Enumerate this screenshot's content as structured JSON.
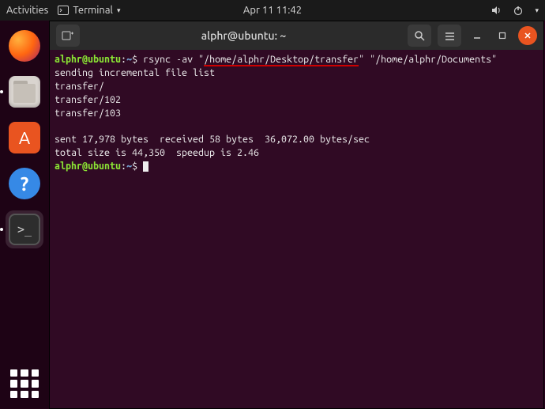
{
  "topbar": {
    "activities": "Activities",
    "app_label": "Terminal",
    "datetime": "Apr 11  11:42"
  },
  "window": {
    "title": "alphr@ubuntu: ~"
  },
  "terminal": {
    "prompt": {
      "user": "alphr",
      "at": "@",
      "host": "ubuntu",
      "sep": ":",
      "path": "~",
      "sym": "$"
    },
    "cmd_prefix": " rsync -av ",
    "cmd_src_q1": "\"",
    "cmd_src": "/home/alphr/Desktop/transfer",
    "cmd_src_q2": "\"",
    "cmd_mid": " ",
    "cmd_dst": "\"/home/alphr/Documents\"",
    "out1": "sending incremental file list",
    "out2": "transfer/",
    "out3": "transfer/102",
    "out4": "transfer/103",
    "out5": "",
    "out6": "sent 17,978 bytes  received 58 bytes  36,072.00 bytes/sec",
    "out7": "total size is 44,350  speedup is 2.46"
  }
}
